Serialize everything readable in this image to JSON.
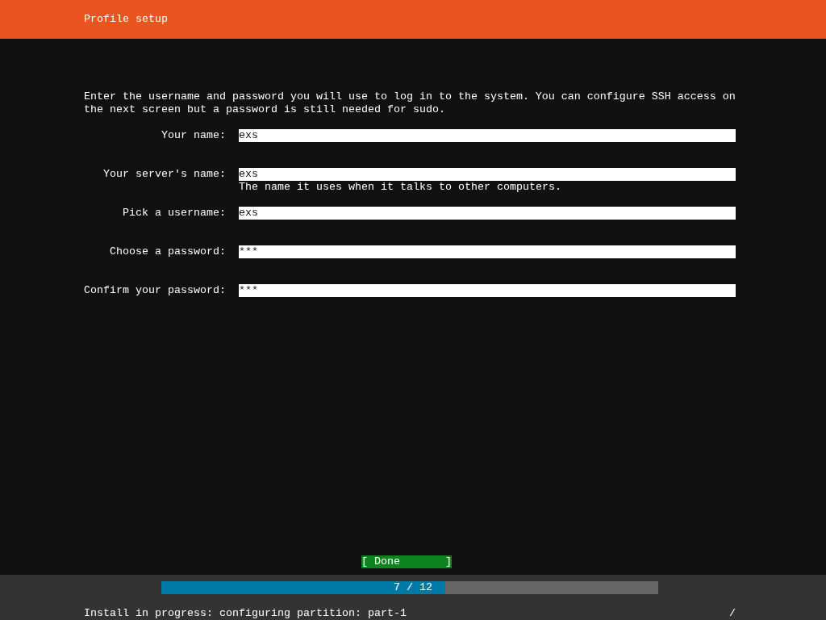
{
  "header": {
    "title": "Profile setup"
  },
  "intro": "Enter the username and password you will use to log in to the system. You can configure SSH access on the next screen but a password is still needed for sudo.",
  "fields": [
    {
      "label": "Your name:",
      "value": "exs"
    },
    {
      "label": "Your server's name:",
      "value": "exs",
      "help": "The name it uses when it talks to other computers."
    },
    {
      "label": "Pick a username:",
      "value": "exs"
    },
    {
      "label": "Choose a password:",
      "value": "***"
    },
    {
      "label": "Confirm your password:",
      "value": "***"
    }
  ],
  "done_button": {
    "label": "[ Done       ]"
  },
  "progress": {
    "level": 0.571,
    "label": "7 / 12"
  },
  "status_bar": {
    "text": "Install in progress: configuring partition: part-1",
    "spinner": "/"
  }
}
